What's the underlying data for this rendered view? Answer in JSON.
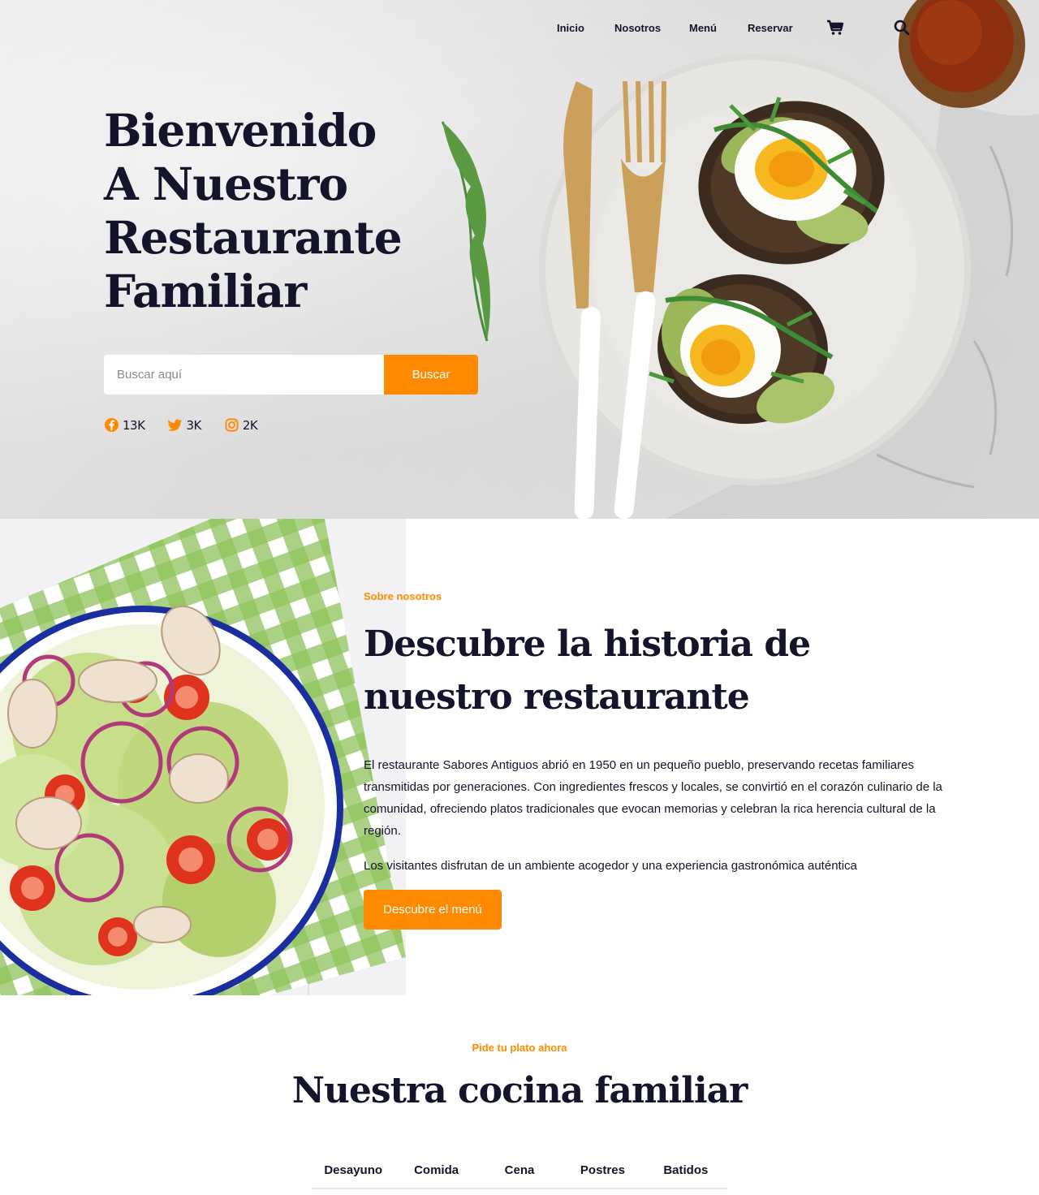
{
  "nav": {
    "links": [
      "Inicio",
      "Nosotros",
      "Menú",
      "Reservar"
    ],
    "cart_icon": "cart-icon",
    "search_icon": "search-icon"
  },
  "hero": {
    "title": "Bienvenido\nA Nuestro\nRestaurante\nFamiliar",
    "search_placeholder": "Buscar aquí",
    "search_button": "Buscar",
    "socials": [
      {
        "icon": "facebook-icon",
        "count": "13K"
      },
      {
        "icon": "twitter-icon",
        "count": "3K"
      },
      {
        "icon": "instagram-icon",
        "count": "2K"
      }
    ]
  },
  "about": {
    "eyebrow": "Sobre nosotros",
    "title": "Descubre la historia de nuestro restaurante",
    "paragraph1": "El restaurante Sabores Antiguos abrió en 1950 en un pequeño pueblo, preservando recetas familiares transmitidas por generaciones. Con ingredientes frescos y locales, se convirtió en el corazón culinario de la comunidad, ofreciendo platos tradicionales que evocan memorias y celebran la rica herencia cultural de la región.",
    "paragraph2": "Los visitantes disfrutan de un ambiente acogedor y una experiencia gastronómica auténtica",
    "button": "Descubre el menú"
  },
  "menu": {
    "eyebrow": "Pide tu plato ahora",
    "title": "Nuestra cocina familiar",
    "tabs": [
      "Desayuno",
      "Comida",
      "Cena",
      "Postres",
      "Batidos"
    ]
  },
  "colors": {
    "accent": "#ff8a00",
    "text": "#14142b"
  }
}
